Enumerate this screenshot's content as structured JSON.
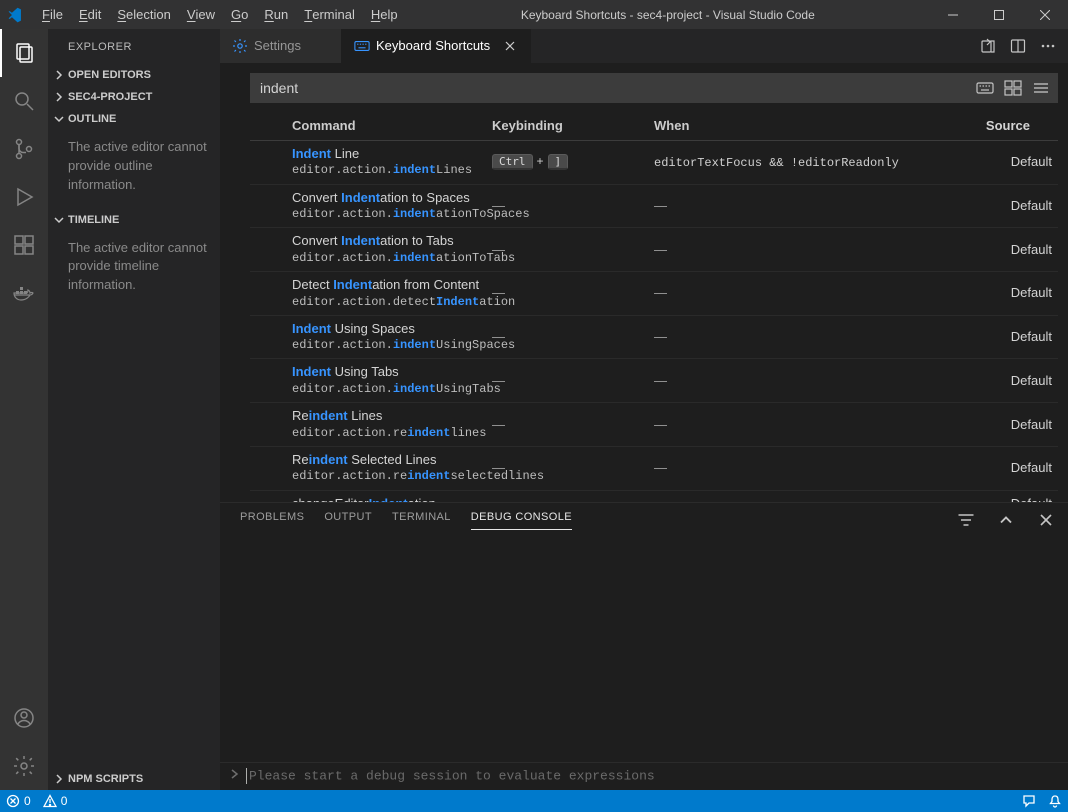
{
  "titlebar": {
    "menus": [
      "File",
      "Edit",
      "Selection",
      "View",
      "Go",
      "Run",
      "Terminal",
      "Help"
    ],
    "title": "Keyboard Shortcuts - sec4-project - Visual Studio Code"
  },
  "sidebar": {
    "title": "EXPLORER",
    "sections": [
      {
        "label": "OPEN EDITORS",
        "expanded": false
      },
      {
        "label": "SEC4-PROJECT",
        "expanded": false
      },
      {
        "label": "OUTLINE",
        "expanded": true,
        "body": "The active editor cannot provide outline information."
      },
      {
        "label": "TIMELINE",
        "expanded": true,
        "body": "The active editor cannot provide timeline information."
      },
      {
        "label": "NPM SCRIPTS",
        "expanded": false
      }
    ]
  },
  "tabs": [
    {
      "label": "Settings",
      "icon": "gear",
      "active": false
    },
    {
      "label": "Keyboard Shortcuts",
      "icon": "keyboard",
      "active": true
    }
  ],
  "kbs": {
    "search_value": "indent",
    "headers": {
      "command": "Command",
      "keybinding": "Keybinding",
      "when": "When",
      "source": "Source"
    },
    "rows": [
      {
        "title_parts": [
          [
            "Indent",
            true
          ],
          [
            " Line",
            false
          ]
        ],
        "id_parts": [
          [
            "editor.action.",
            false
          ],
          [
            "indent",
            true
          ],
          [
            "Lines",
            false
          ]
        ],
        "keys": [
          "Ctrl",
          "]"
        ],
        "when": "editorTextFocus && !editorReadonly",
        "source": "Default"
      },
      {
        "title_parts": [
          [
            "Convert ",
            false
          ],
          [
            "Indent",
            true
          ],
          [
            "ation to Spaces",
            false
          ]
        ],
        "id_parts": [
          [
            "editor.action.",
            false
          ],
          [
            "indent",
            true
          ],
          [
            "ationToSpaces",
            false
          ]
        ],
        "keys": null,
        "when": "",
        "source": "Default"
      },
      {
        "title_parts": [
          [
            "Convert ",
            false
          ],
          [
            "Indent",
            true
          ],
          [
            "ation to Tabs",
            false
          ]
        ],
        "id_parts": [
          [
            "editor.action.",
            false
          ],
          [
            "indent",
            true
          ],
          [
            "ationToTabs",
            false
          ]
        ],
        "keys": null,
        "when": "",
        "source": "Default"
      },
      {
        "title_parts": [
          [
            "Detect ",
            false
          ],
          [
            "Indent",
            true
          ],
          [
            "ation from Content",
            false
          ]
        ],
        "id_parts": [
          [
            "editor.action.detect",
            false
          ],
          [
            "Indent",
            true
          ],
          [
            "ation",
            false
          ]
        ],
        "keys": null,
        "when": "",
        "source": "Default"
      },
      {
        "title_parts": [
          [
            "Indent",
            true
          ],
          [
            " Using Spaces",
            false
          ]
        ],
        "id_parts": [
          [
            "editor.action.",
            false
          ],
          [
            "indent",
            true
          ],
          [
            "UsingSpaces",
            false
          ]
        ],
        "keys": null,
        "when": "",
        "source": "Default"
      },
      {
        "title_parts": [
          [
            "Indent",
            true
          ],
          [
            " Using Tabs",
            false
          ]
        ],
        "id_parts": [
          [
            "editor.action.",
            false
          ],
          [
            "indent",
            true
          ],
          [
            "UsingTabs",
            false
          ]
        ],
        "keys": null,
        "when": "",
        "source": "Default"
      },
      {
        "title_parts": [
          [
            "Re",
            false
          ],
          [
            "indent",
            true
          ],
          [
            " Lines",
            false
          ]
        ],
        "id_parts": [
          [
            "editor.action.re",
            false
          ],
          [
            "indent",
            true
          ],
          [
            "lines",
            false
          ]
        ],
        "keys": null,
        "when": "",
        "source": "Default"
      },
      {
        "title_parts": [
          [
            "Re",
            false
          ],
          [
            "indent",
            true
          ],
          [
            " Selected Lines",
            false
          ]
        ],
        "id_parts": [
          [
            "editor.action.re",
            false
          ],
          [
            "indent",
            true
          ],
          [
            "selectedlines",
            false
          ]
        ],
        "keys": null,
        "when": "",
        "source": "Default"
      },
      {
        "title_parts": [
          [
            "changeEditor",
            false
          ],
          [
            "Indent",
            true
          ],
          [
            "ation",
            false
          ]
        ],
        "id_parts": [],
        "keys": null,
        "when": "",
        "source": "Default"
      }
    ]
  },
  "panel": {
    "tabs": [
      "PROBLEMS",
      "OUTPUT",
      "TERMINAL",
      "DEBUG CONSOLE"
    ],
    "active": 3,
    "debug_placeholder": "Please start a debug session to evaluate expressions"
  },
  "statusbar": {
    "errors": "0",
    "warnings": "0"
  }
}
